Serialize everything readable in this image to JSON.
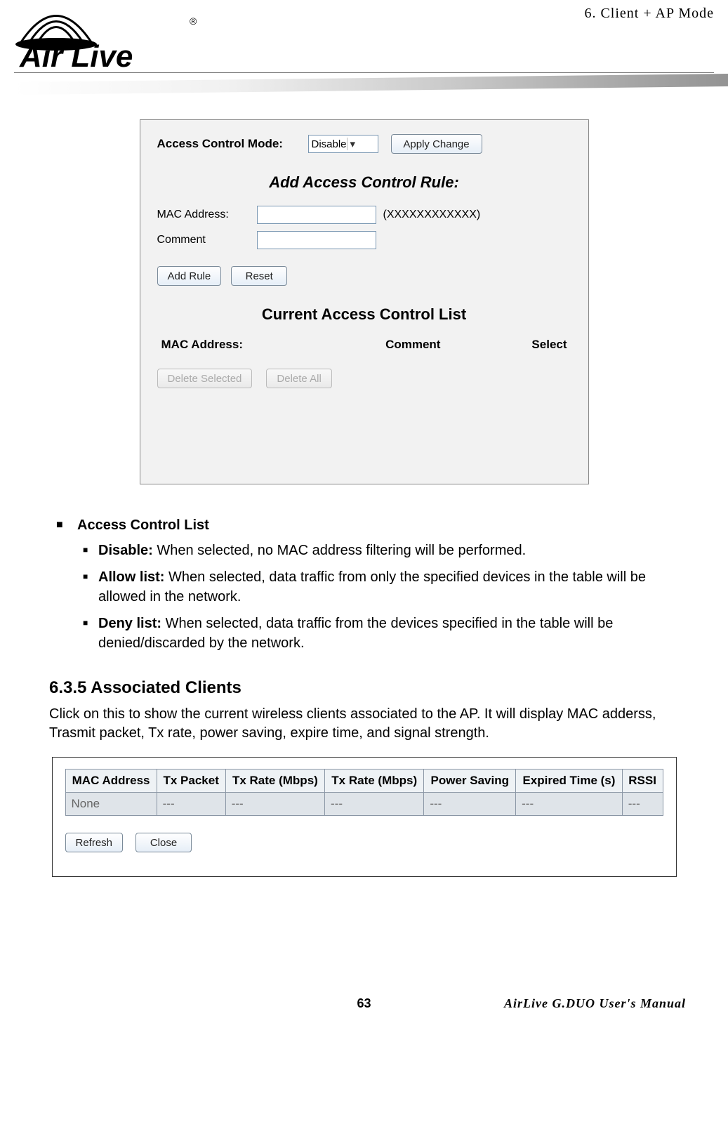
{
  "header": {
    "chapter": "6.   Client + AP Mode",
    "logo_alt": "AirLive"
  },
  "panel1": {
    "acm_label": "Access Control Mode:",
    "acm_value": "Disable",
    "apply_btn": "Apply Change",
    "add_rule_title": "Add Access Control Rule:",
    "mac_label": "MAC Address:",
    "mac_hint": "(XXXXXXXXXXXX)",
    "comment_label": "Comment",
    "add_rule_btn": "Add Rule",
    "reset_btn": "Reset",
    "list_title": "Current Access Control List",
    "th_mac": "MAC Address:",
    "th_comment": "Comment",
    "th_select": "Select",
    "delete_selected_btn": "Delete Selected",
    "delete_all_btn": "Delete All"
  },
  "explain": {
    "heading": "Access Control List",
    "items": [
      {
        "label": "Disable:",
        "text": " When selected, no MAC address filtering will be performed."
      },
      {
        "label": "Allow list:",
        "text": " When selected, data traffic from only the specified devices in the table will be allowed in the network."
      },
      {
        "label": "Deny list:",
        "text": " When selected, data traffic from the devices specified in the table will be denied/discarded by the network."
      }
    ]
  },
  "section": {
    "heading": "6.3.5 Associated Clients",
    "para": "Click on this to show the current wireless clients associated to the AP.   It will display MAC adderss, Trasmit packet, Tx rate, power saving, expire time, and signal strength."
  },
  "panel2": {
    "headers": [
      "MAC Address",
      "Tx Packet",
      "Tx Rate (Mbps)",
      "Tx Rate (Mbps)",
      "Power Saving",
      "Expired Time (s)",
      "RSSI"
    ],
    "row": [
      "None",
      "---",
      "---",
      "---",
      "---",
      "---",
      "---"
    ],
    "refresh_btn": "Refresh",
    "close_btn": "Close"
  },
  "footer": {
    "page": "63",
    "right": "AirLive G.DUO User's Manual"
  }
}
